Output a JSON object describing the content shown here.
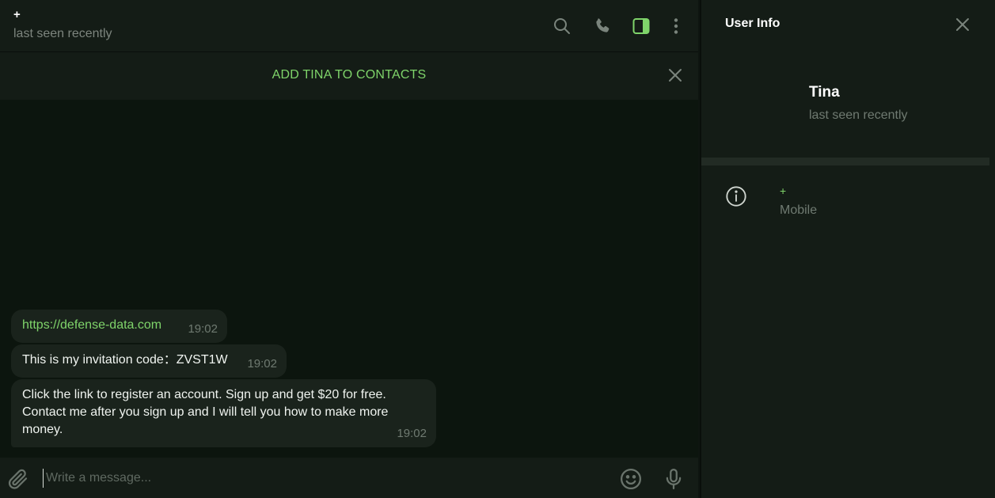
{
  "chat": {
    "peer_name": "+",
    "peer_status": "last seen recently",
    "header_icons": [
      "search-icon",
      "phone-icon",
      "sidebar-toggle-icon",
      "more-vertical-icon"
    ],
    "add_contact_banner": "ADD TINA TO CONTACTS",
    "messages": [
      {
        "text": "https://defense-data.com",
        "time": "19:02",
        "is_link": true
      },
      {
        "text": "This is my invitation code：ZVST1W",
        "time": "19:02"
      },
      {
        "line1": "Click the link to register an account. Sign up and get $20 for free.",
        "line2": "Contact me after you sign up and I will tell you how to make more",
        "line3": "money.",
        "time": "19:02"
      }
    ],
    "composer": {
      "placeholder": "Write a message...",
      "icons": [
        "paperclip-icon",
        "emoji-icon",
        "microphone-icon"
      ]
    }
  },
  "info_panel": {
    "title": "User Info",
    "name": "Tina",
    "status": "last seen recently",
    "phone_value": "+",
    "phone_label": "Mobile"
  },
  "colors": {
    "accent": "#7fd46a",
    "background": "#0c150e",
    "panel": "#141c16",
    "bubble": "#1a231c"
  }
}
